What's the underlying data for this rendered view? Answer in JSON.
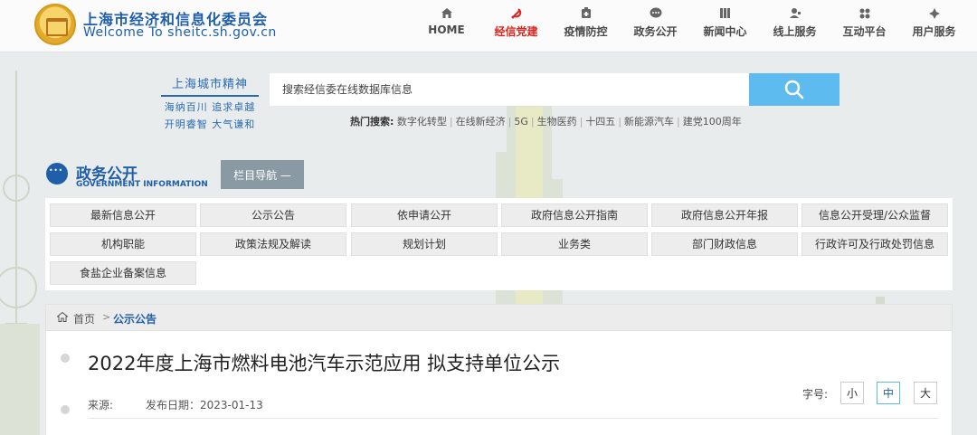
{
  "site": {
    "name_cn": "上海市经济和信息化委员会",
    "name_en": "Welcome To sheitc.sh.gov.cn"
  },
  "nav": [
    {
      "label": "HOME",
      "icon": "home-icon",
      "active": false
    },
    {
      "label": "经信党建",
      "icon": "party-emblem-icon",
      "active": true
    },
    {
      "label": "疫情防控",
      "icon": "shield-icon",
      "active": false
    },
    {
      "label": "政务公开",
      "icon": "chat-bubble-icon",
      "active": false
    },
    {
      "label": "新闻中心",
      "icon": "news-icon",
      "active": false
    },
    {
      "label": "线上服务",
      "icon": "user-service-icon",
      "active": false
    },
    {
      "label": "互动平台",
      "icon": "interact-icon",
      "active": false
    },
    {
      "label": "用户服务",
      "icon": "user-icon",
      "active": false
    }
  ],
  "spirit": {
    "title": "上海城市精神",
    "line1": "海纳百川 追求卓越",
    "line2": "开明睿智 大气谦和"
  },
  "search": {
    "placeholder": "搜索经信委在线数据库信息"
  },
  "hot": {
    "label": "热门搜索:",
    "items": [
      "数字化转型",
      "在线新经济",
      "5G",
      "生物医药",
      "十四五",
      "新能源汽车",
      "建党100周年"
    ]
  },
  "section": {
    "title": "政务公开",
    "subtitle": "GOVERNMENT INFORMATION",
    "nav_button": "栏目导航 —"
  },
  "categories": [
    "最新信息公开",
    "公示公告",
    "依申请公开",
    "政府信息公开指南",
    "政府信息公开年报",
    "信息公开受理/公众监督",
    "机构职能",
    "政策法规及解读",
    "规划计划",
    "业务类",
    "部门财政信息",
    "行政许可及行政处罚信息",
    "食盐企业备案信息"
  ],
  "breadcrumb": {
    "home": "首页",
    "sep": ">",
    "current": "公示公告"
  },
  "article": {
    "title": "2022年度上海市燃料电池汽车示范应用 拟支持单位公示",
    "source_label": "来源:",
    "date_text": "发布日期：2023-01-13",
    "font_size_label": "字号:",
    "sizes": [
      "小",
      "中",
      "大"
    ],
    "active_size": "中"
  },
  "colors": {
    "brand_blue": "#1f5ea8",
    "active_red": "#d8261f",
    "search_button": "#5dbbef"
  }
}
